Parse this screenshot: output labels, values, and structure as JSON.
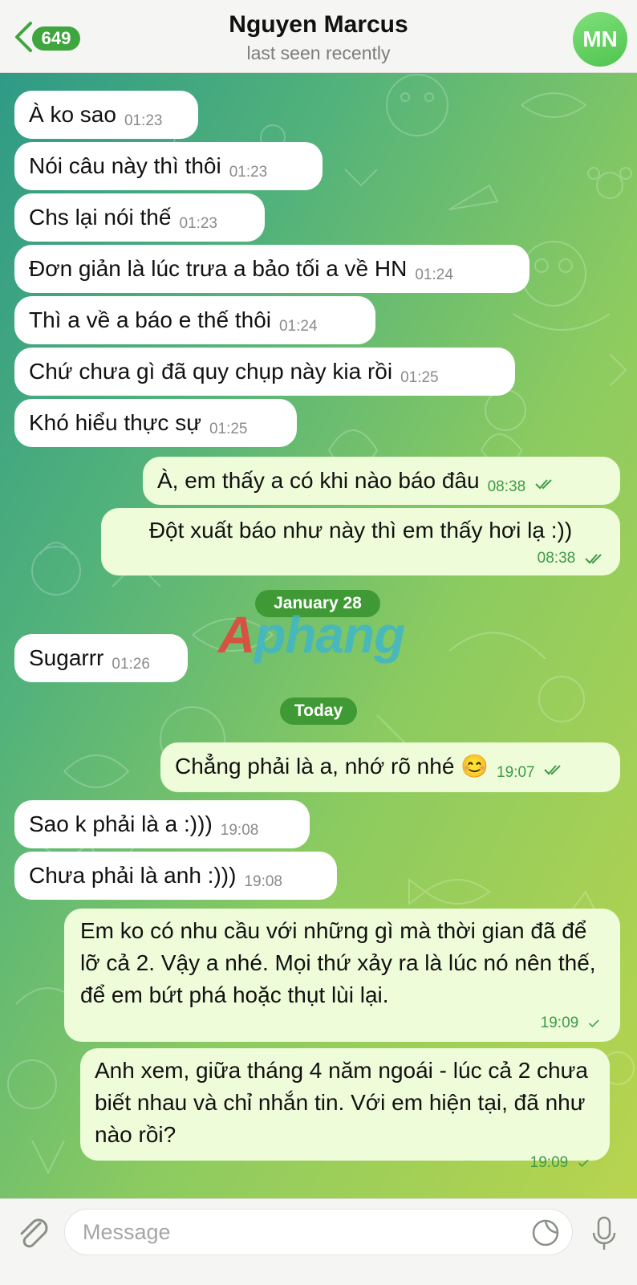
{
  "header": {
    "back_count": "649",
    "contact_name": "Nguyen Marcus",
    "status": "last seen recently",
    "avatar_initials": "MN"
  },
  "messages": [
    {
      "dir": "in",
      "text": "À ko sao",
      "time": "01:23"
    },
    {
      "dir": "in",
      "text": "Nói câu này thì thôi",
      "time": "01:23"
    },
    {
      "dir": "in",
      "text": "Chs lại nói thế",
      "time": "01:23"
    },
    {
      "dir": "in",
      "text": "Đơn giản là lúc trưa a bảo tối a về HN",
      "time": "01:24"
    },
    {
      "dir": "in",
      "text": "Thì a về a báo e thế thôi",
      "time": "01:24"
    },
    {
      "dir": "in",
      "text": "Chứ chưa gì đã quy chụp này kia rồi",
      "time": "01:25"
    },
    {
      "dir": "in",
      "text": "Khó hiểu thực sự",
      "time": "01:25"
    },
    {
      "dir": "out",
      "text": "À, em thấy a có khi nào báo đâu",
      "time": "08:38",
      "status": "read"
    },
    {
      "dir": "out",
      "text": "Đột xuất báo như này thì em thấy hơi lạ :))",
      "time": "08:38",
      "status": "read"
    },
    {
      "dir": "in",
      "text": "Sugarrr",
      "time": "01:26"
    },
    {
      "dir": "out",
      "text": "Chẳng phải là a, nhớ rõ nhé 😊",
      "time": "19:07",
      "status": "read"
    },
    {
      "dir": "in",
      "text": "Sao k phải là a :)))",
      "time": "19:08"
    },
    {
      "dir": "in",
      "text": "Chưa phải là anh :)))",
      "time": "19:08"
    },
    {
      "dir": "out",
      "text": "Em ko có nhu cầu với những gì mà thời gian đã để lỡ cả 2. Vậy a nhé. Mọi thứ xảy ra là lúc nó nên thế, để em bứt phá hoặc thụt lùi lại.",
      "time": "19:09",
      "status": "sent"
    },
    {
      "dir": "out",
      "text": "Anh xem, giữa tháng 4 năm ngoái - lúc cả 2 chưa biết nhau và chỉ nhắn tin. Với em hiện tại, đã như nào rồi?",
      "time": "19:09",
      "status": "sent"
    }
  ],
  "date_separators": [
    "January 28",
    "Today"
  ],
  "watermark": {
    "part1": "A",
    "part2": "phang"
  },
  "input": {
    "placeholder": "Message"
  },
  "colors": {
    "accent": "#3fa53f",
    "outgoing_bubble": "#eefcd9",
    "incoming_bubble": "#ffffff",
    "read_ticks": "#3f9a48"
  },
  "icons": [
    "back-chevron-icon",
    "attach-icon",
    "sticker-icon",
    "microphone-icon",
    "double-check-icon",
    "single-check-icon"
  ]
}
